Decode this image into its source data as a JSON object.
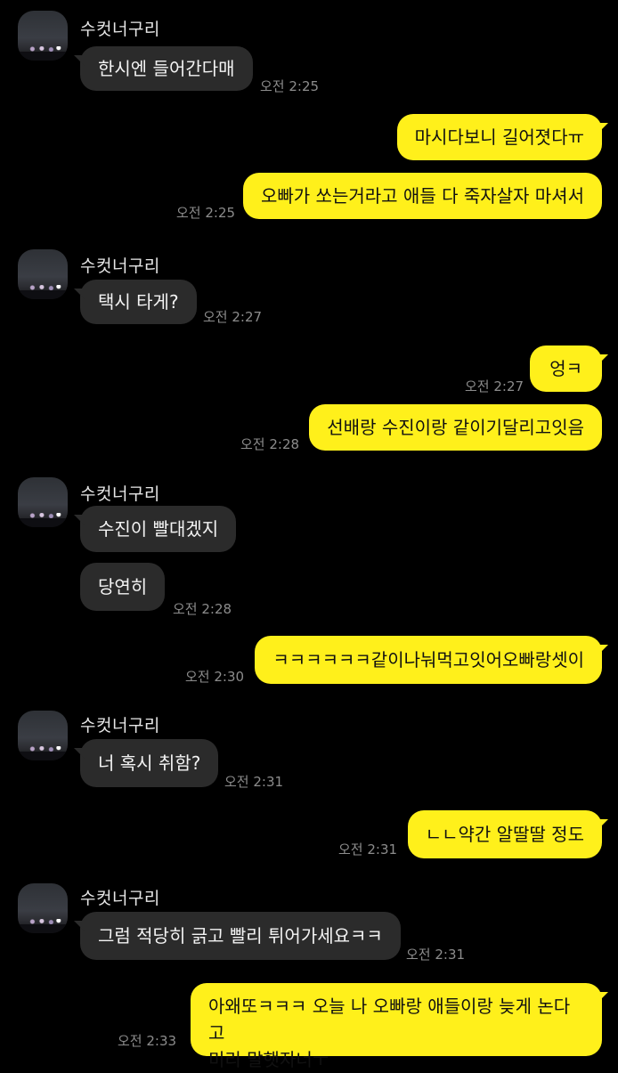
{
  "contact": {
    "name": "수컷너구리"
  },
  "messages": [
    {
      "text": "한시엔 들어간다매",
      "time": "오전 2:25"
    },
    {
      "text": "마시다보니 길어졋다ㅠ"
    },
    {
      "text": "오빠가 쏘는거라고 애들 다 죽자살자 마셔서",
      "time": "오전 2:25"
    },
    {
      "text": "택시 타게?",
      "time": "오전 2:27"
    },
    {
      "text": "엉ㅋ",
      "time": "오전 2:27"
    },
    {
      "text": "선배랑 수진이랑 같이기달리고잇음",
      "time": "오전 2:28"
    },
    {
      "text": "수진이 빨대겠지"
    },
    {
      "text": "당연히",
      "time": "오전 2:28"
    },
    {
      "text": "ㅋㅋㅋㅋㅋㅋ같이나눠먹고잇어오빠랑셋이",
      "time": "오전 2:30"
    },
    {
      "text": "너 혹시 취함?",
      "time": "오전 2:31"
    },
    {
      "text": "ㄴㄴ약간 알딸딸 정도",
      "time": "오전 2:31"
    },
    {
      "text": "그럼 적당히 긁고 빨리 튀어가세요ㅋㅋ",
      "time": "오전 2:31"
    },
    {
      "line1": "아왜또ㅋㅋㅋ 오늘 나 오빠랑 애들이랑 늦게 논다고",
      "line2": "미리 말햇자너ㅜ",
      "time": "오전 2:33"
    }
  ],
  "colors": {
    "received_bubble": "#2b2b2b",
    "sent_bubble": "#fff01b",
    "background": "#000000",
    "time_text": "#8c8c8c"
  }
}
